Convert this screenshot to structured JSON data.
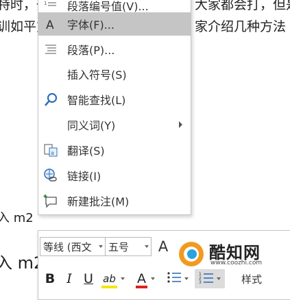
{
  "document": {
    "line1_left": "特时，一",
    "line1_right": "大家都会打，但是",
    "line2_left": "训如平方",
    "line2_right": "家介绍几种方法",
    "line3": "入 m2",
    "line4": "入 m2"
  },
  "context_menu": {
    "items": [
      {
        "label": "段落编号值(V)...",
        "icon": "numbering-icon"
      },
      {
        "label": "字体(F)...",
        "icon": "font-icon",
        "hover": true
      },
      {
        "label": "段落(P)...",
        "icon": "paragraph-icon"
      },
      {
        "label": "插入符号(S)",
        "icon": ""
      },
      {
        "label": "智能查找(L)",
        "icon": "smart-lookup-icon"
      },
      {
        "label": "同义词(Y)",
        "icon": "",
        "submenu": true
      },
      {
        "label": "翻译(S)",
        "icon": "translate-icon"
      },
      {
        "label": "链接(I)",
        "icon": "link-icon"
      },
      {
        "label": "新建批注(M)",
        "icon": "new-comment-icon"
      }
    ]
  },
  "mini_toolbar": {
    "font_name": "等线 (西文",
    "font_size": "五号",
    "grow_font_glyph": "A",
    "bold": "B",
    "italic": "I",
    "underline": "U",
    "highlight_glyph": "ab",
    "font_color_glyph": "A",
    "styles_label": "样式",
    "font_color": "#e0201c",
    "highlight_color": "#f4e60a"
  },
  "watermark": {
    "title": "酷知网",
    "url": "www.coozhi.com"
  }
}
